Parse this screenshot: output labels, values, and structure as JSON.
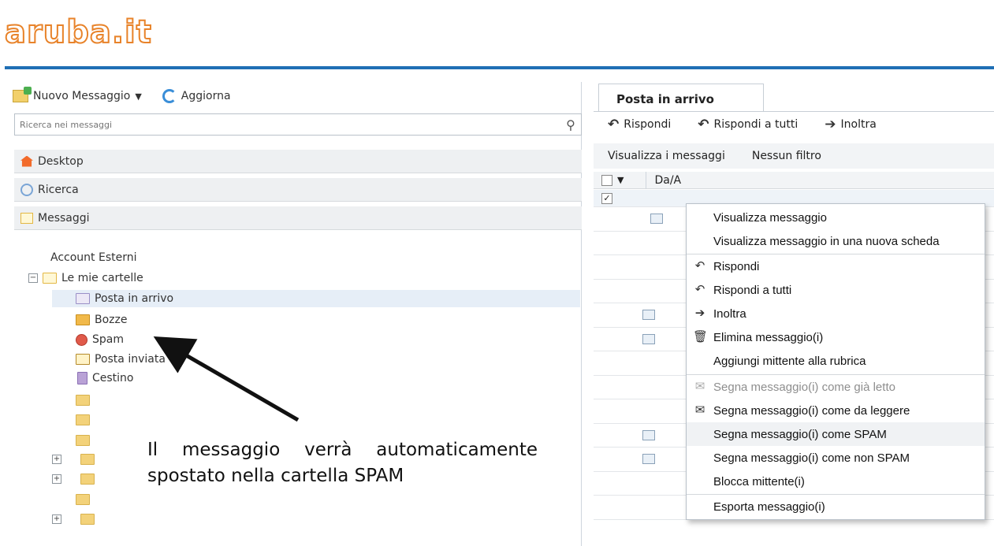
{
  "brand": {
    "logo_text": "aruba.it"
  },
  "left_panel": {
    "new_message_label": "Nuovo Messaggio",
    "refresh_label": "Aggiorna",
    "search_placeholder": "Ricerca nei messaggi",
    "nav": [
      "Desktop",
      "Ricerca",
      "Messaggi"
    ],
    "tree": {
      "external_accounts": "Account Esterni",
      "my_folders": "Le mie cartelle",
      "folders": [
        "Posta in arrivo",
        "Bozze",
        "Spam",
        "Posta inviata",
        "Cestino"
      ]
    }
  },
  "annotation": {
    "line1": "Il messaggio verrà automaticamente",
    "line2": "spostato nella cartella SPAM"
  },
  "right_panel": {
    "tab_label": "Posta in arrivo",
    "actions": [
      "Rispondi",
      "Rispondi a tutti",
      "Inoltra"
    ],
    "filters": {
      "view_label": "Visualizza i messaggi",
      "filter_value": "Nessun filtro"
    },
    "column_from": "Da/A"
  },
  "context_menu": {
    "items": [
      "Visualizza messaggio",
      "Visualizza messaggio in una nuova scheda",
      "Rispondi",
      "Rispondi a tutti",
      "Inoltra",
      "Elimina messaggio(i)",
      "Aggiungi mittente alla rubrica",
      "Segna messaggio(i) come già letto",
      "Segna messaggio(i) come da leggere",
      "Segna messaggio(i) come SPAM",
      "Segna messaggio(i) come non SPAM",
      "Blocca mittente(i)",
      "Esporta messaggio(i)"
    ]
  },
  "colors": {
    "accent": "#1f6fb5",
    "brand": "#e8832a"
  }
}
